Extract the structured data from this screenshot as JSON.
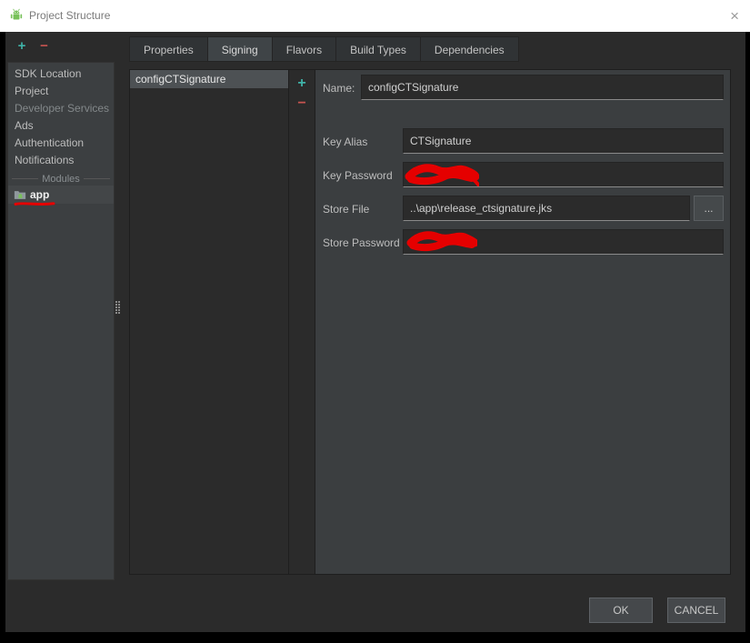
{
  "titlebar": {
    "title": "Project Structure",
    "close_icon": "×"
  },
  "sidebar_toolbar": {
    "add_icon": "+",
    "remove_icon": "−"
  },
  "sidebar": {
    "items": [
      {
        "label": "SDK Location",
        "type": "item"
      },
      {
        "label": "Project",
        "type": "item"
      },
      {
        "label": "Developer Services",
        "type": "header"
      },
      {
        "label": "Ads",
        "type": "item"
      },
      {
        "label": "Authentication",
        "type": "item"
      },
      {
        "label": "Notifications",
        "type": "item"
      }
    ],
    "modules_separator": "Modules",
    "module": {
      "label": "app",
      "selected": true
    }
  },
  "tabs": [
    {
      "label": "Properties",
      "selected": false
    },
    {
      "label": "Signing",
      "selected": true
    },
    {
      "label": "Flavors",
      "selected": false
    },
    {
      "label": "Build Types",
      "selected": false
    },
    {
      "label": "Dependencies",
      "selected": false
    }
  ],
  "config_list": {
    "selected_item": "configCTSignature",
    "add_icon": "+",
    "remove_icon": "−"
  },
  "form": {
    "name_label": "Name:",
    "name_value": "configCTSignature",
    "key_alias_label": "Key Alias",
    "key_alias_value": "CTSignature",
    "key_password_label": "Key Password",
    "key_password_value": "",
    "store_file_label": "Store File",
    "store_file_value": "..\\app\\release_ctsignature.jks",
    "browse_label": "...",
    "store_password_label": "Store Password",
    "store_password_value": ""
  },
  "footer": {
    "ok": "OK",
    "cancel": "CANCEL"
  },
  "colors": {
    "add_accent": "#3fb3a8",
    "remove_accent": "#c75450",
    "redaction": "#e50000",
    "panel": "#3c3f41",
    "background": "#2b2b2b"
  }
}
